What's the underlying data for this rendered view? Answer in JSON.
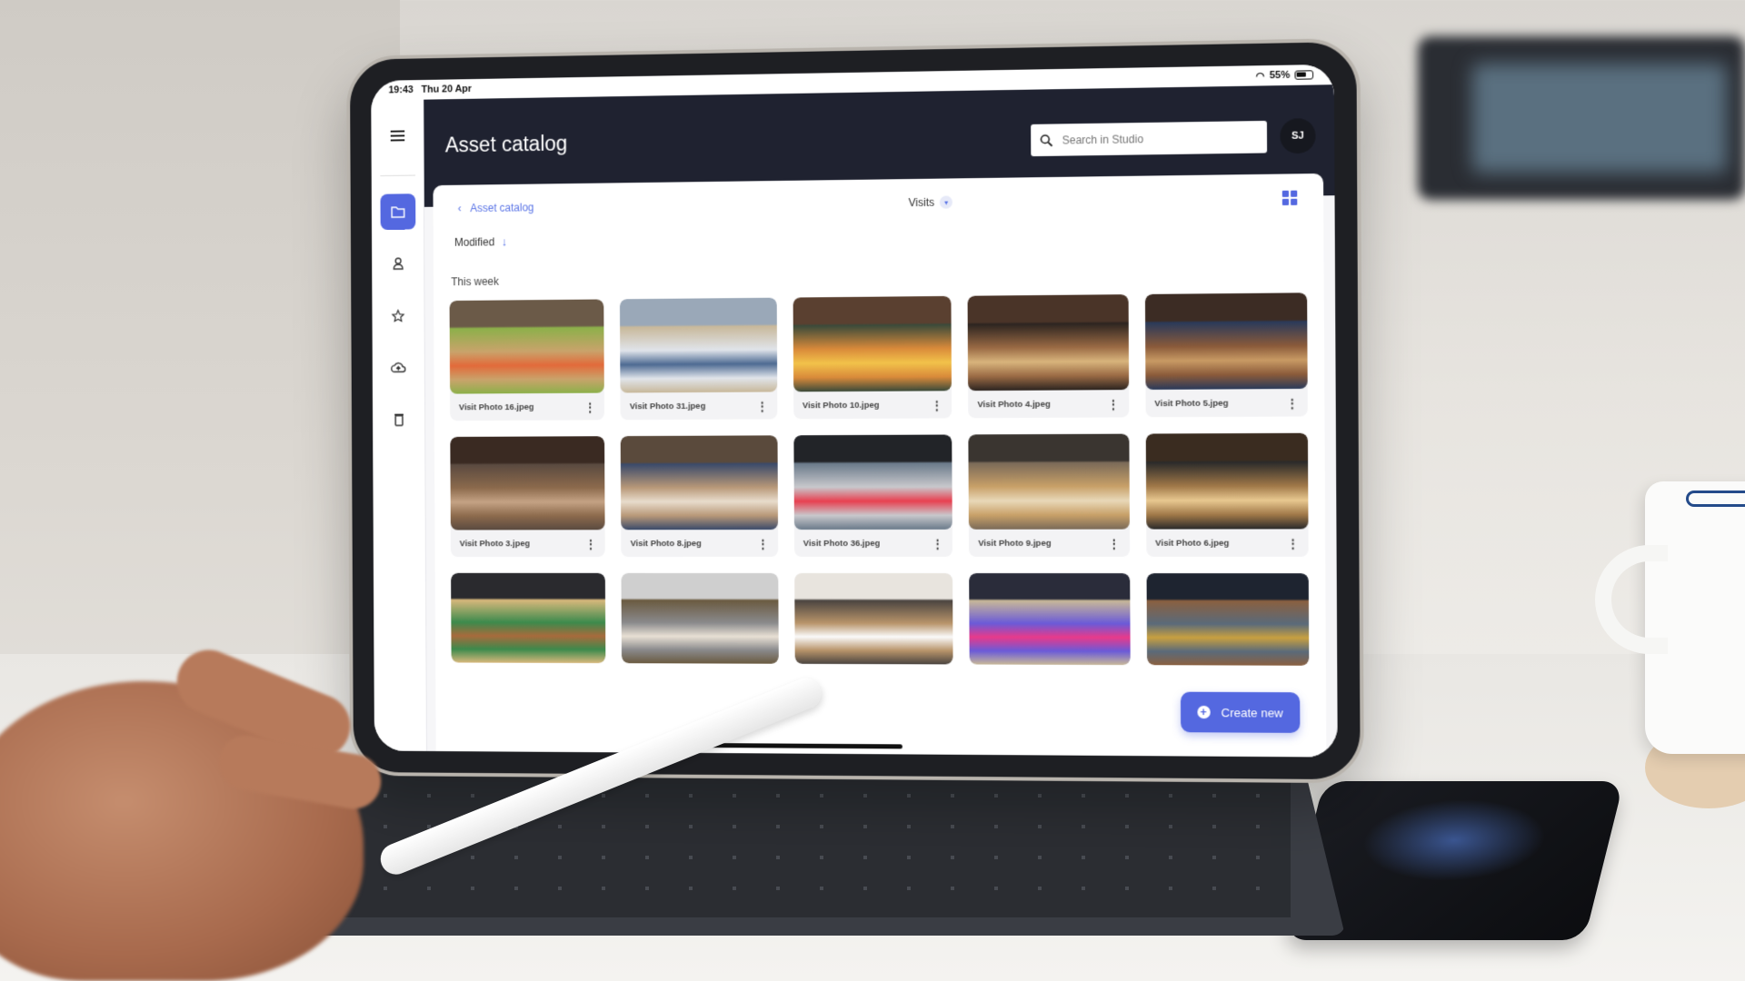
{
  "status_bar": {
    "time": "19:43",
    "date": "Thu 20 Apr",
    "battery": "55%"
  },
  "sidebar": {
    "items": [
      {
        "name": "menu",
        "icon": "hamburger-icon"
      },
      {
        "name": "assets",
        "icon": "folder-icon",
        "active": true
      },
      {
        "name": "users",
        "icon": "person-icon"
      },
      {
        "name": "favorites",
        "icon": "star-icon"
      },
      {
        "name": "upload",
        "icon": "cloud-upload-icon"
      },
      {
        "name": "trash",
        "icon": "trash-icon"
      }
    ]
  },
  "header": {
    "title": "Asset catalog",
    "search_placeholder": "Search in Studio",
    "avatar_initials": "SJ"
  },
  "panel": {
    "breadcrumb": "Asset catalog",
    "filter_label": "Visits",
    "sort_label": "Modified",
    "section_label": "This week",
    "accent_color": "#5468e0"
  },
  "photos": [
    {
      "name": "Visit Photo 16.jpeg"
    },
    {
      "name": "Visit Photo 31.jpeg"
    },
    {
      "name": "Visit Photo 10.jpeg"
    },
    {
      "name": "Visit Photo 4.jpeg"
    },
    {
      "name": "Visit Photo 5.jpeg"
    },
    {
      "name": "Visit Photo 3.jpeg"
    },
    {
      "name": "Visit Photo 8.jpeg"
    },
    {
      "name": "Visit Photo 36.jpeg"
    },
    {
      "name": "Visit Photo 9.jpeg"
    },
    {
      "name": "Visit Photo 6.jpeg"
    },
    {
      "name": ""
    },
    {
      "name": ""
    },
    {
      "name": ""
    },
    {
      "name": ""
    },
    {
      "name": ""
    }
  ],
  "fab": {
    "label": "Create new"
  }
}
